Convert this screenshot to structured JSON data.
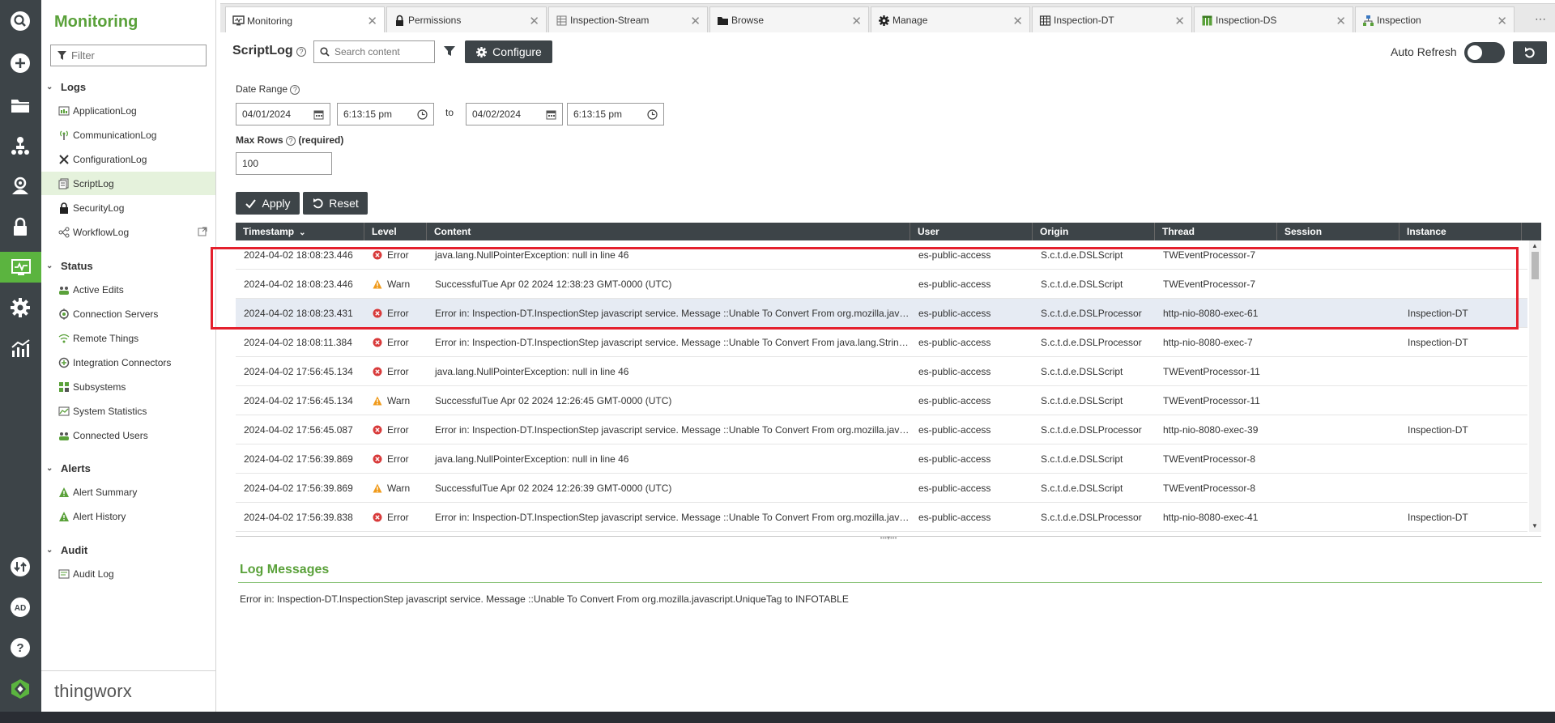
{
  "sidebar": {
    "title": "Monitoring",
    "filter_placeholder": "Filter",
    "sections": {
      "logs": {
        "label": "Logs",
        "items": [
          "ApplicationLog",
          "CommunicationLog",
          "ConfigurationLog",
          "ScriptLog",
          "SecurityLog",
          "WorkflowLog"
        ]
      },
      "status": {
        "label": "Status",
        "items": [
          "Active Edits",
          "Connection Servers",
          "Remote Things",
          "Integration Connectors",
          "Subsystems",
          "System Statistics",
          "Connected Users"
        ]
      },
      "alerts": {
        "label": "Alerts",
        "items": [
          "Alert Summary",
          "Alert History"
        ]
      },
      "audit": {
        "label": "Audit",
        "items": [
          "Audit Log"
        ]
      }
    },
    "active_item": "ScriptLog",
    "brand": "thingworx"
  },
  "rail": {
    "icons": [
      "search-icon",
      "plus-icon",
      "folder-icon",
      "hierarchy-icon",
      "eye-icon",
      "lock-icon",
      "monitoring-icon",
      "gear-icon",
      "analytics-icon",
      "sync-icon",
      "user-avatar",
      "help-icon"
    ],
    "avatar_initials": "AD"
  },
  "tabs": [
    {
      "label": "Monitoring",
      "icon": "monitor-icon",
      "active": true
    },
    {
      "label": "Permissions",
      "icon": "lock-icon"
    },
    {
      "label": "Inspection-Stream",
      "icon": "stream-icon"
    },
    {
      "label": "Browse",
      "icon": "folder-icon"
    },
    {
      "label": "Manage",
      "icon": "gear-icon"
    },
    {
      "label": "Inspection-DT",
      "icon": "table-icon"
    },
    {
      "label": "Inspection-DS",
      "icon": "datashape-icon"
    },
    {
      "label": "Inspection",
      "icon": "thing-icon"
    }
  ],
  "toolbar": {
    "title": "ScriptLog",
    "search_placeholder": "Search content",
    "configure_label": "Configure",
    "auto_refresh_label": "Auto Refresh",
    "auto_refresh_on": false
  },
  "form": {
    "date_range_label": "Date Range",
    "start_date": "04/01/2024",
    "start_time": "6:13:15 pm",
    "to_label": "to",
    "end_date": "04/02/2024",
    "end_time": "6:13:15 pm",
    "max_rows_label": "Max Rows",
    "required_label": "(required)",
    "max_rows": "100",
    "apply_label": "Apply",
    "reset_label": "Reset"
  },
  "grid": {
    "columns": [
      "Timestamp",
      "Level",
      "Content",
      "User",
      "Origin",
      "Thread",
      "Session",
      "Instance"
    ],
    "rows": [
      {
        "timestamp": "2024-04-02 18:08:23.446",
        "level": "Error",
        "content": "java.lang.NullPointerException: null in line 46",
        "user": "es-public-access",
        "origin": "S.c.t.d.e.DSLScript",
        "thread": "TWEventProcessor-7",
        "session": "",
        "instance": ""
      },
      {
        "timestamp": "2024-04-02 18:08:23.446",
        "level": "Warn",
        "content": "SuccessfulTue Apr 02 2024 12:38:23 GMT-0000 (UTC)",
        "user": "es-public-access",
        "origin": "S.c.t.d.e.DSLScript",
        "thread": "TWEventProcessor-7",
        "session": "",
        "instance": ""
      },
      {
        "timestamp": "2024-04-02 18:08:23.431",
        "level": "Error",
        "content": "Error in: Inspection-DT.InspectionStep javascript service. Message ::Unable To Convert From org.mozilla.javascript.UniqueTag to INFOTABLE",
        "user": "es-public-access",
        "origin": "S.c.t.d.e.DSLProcessor",
        "thread": "http-nio-8080-exec-61",
        "session": "",
        "instance": "Inspection-DT",
        "selected": true
      },
      {
        "timestamp": "2024-04-02 18:08:11.384",
        "level": "Error",
        "content": "Error in: Inspection-DT.InspectionStep javascript service. Message ::Unable To Convert From java.lang.String to INFOTABLE",
        "user": "es-public-access",
        "origin": "S.c.t.d.e.DSLProcessor",
        "thread": "http-nio-8080-exec-7",
        "session": "",
        "instance": "Inspection-DT"
      },
      {
        "timestamp": "2024-04-02 17:56:45.134",
        "level": "Error",
        "content": "java.lang.NullPointerException: null in line 46",
        "user": "es-public-access",
        "origin": "S.c.t.d.e.DSLScript",
        "thread": "TWEventProcessor-11",
        "session": "",
        "instance": ""
      },
      {
        "timestamp": "2024-04-02 17:56:45.134",
        "level": "Warn",
        "content": "SuccessfulTue Apr 02 2024 12:26:45 GMT-0000 (UTC)",
        "user": "es-public-access",
        "origin": "S.c.t.d.e.DSLScript",
        "thread": "TWEventProcessor-11",
        "session": "",
        "instance": ""
      },
      {
        "timestamp": "2024-04-02 17:56:45.087",
        "level": "Error",
        "content": "Error in: Inspection-DT.InspectionStep javascript service. Message ::Unable To Convert From org.mozilla.javascript.UniqueTag to INFOTABLE",
        "user": "es-public-access",
        "origin": "S.c.t.d.e.DSLProcessor",
        "thread": "http-nio-8080-exec-39",
        "session": "",
        "instance": "Inspection-DT"
      },
      {
        "timestamp": "2024-04-02 17:56:39.869",
        "level": "Error",
        "content": "java.lang.NullPointerException: null in line 46",
        "user": "es-public-access",
        "origin": "S.c.t.d.e.DSLScript",
        "thread": "TWEventProcessor-8",
        "session": "",
        "instance": ""
      },
      {
        "timestamp": "2024-04-02 17:56:39.869",
        "level": "Warn",
        "content": "SuccessfulTue Apr 02 2024 12:26:39 GMT-0000 (UTC)",
        "user": "es-public-access",
        "origin": "S.c.t.d.e.DSLScript",
        "thread": "TWEventProcessor-8",
        "session": "",
        "instance": ""
      },
      {
        "timestamp": "2024-04-02 17:56:39.838",
        "level": "Error",
        "content": "Error in: Inspection-DT.InspectionStep javascript service. Message ::Unable To Convert From org.mozilla.javascript.UniqueTag to INFOTABLE",
        "user": "es-public-access",
        "origin": "S.c.t.d.e.DSLProcessor",
        "thread": "http-nio-8080-exec-41",
        "session": "",
        "instance": "Inspection-DT"
      }
    ]
  },
  "log_messages": {
    "title": "Log Messages",
    "text": "Error in: Inspection-DT.InspectionStep javascript service. Message ::Unable To Convert From org.mozilla.javascript.UniqueTag to INFOTABLE"
  },
  "colors": {
    "accent_green": "#5aa13a",
    "dark": "#3d4448",
    "error_red": "#d83a3a",
    "warn_orange": "#f09a1a",
    "highlight_red": "#e4202d"
  }
}
